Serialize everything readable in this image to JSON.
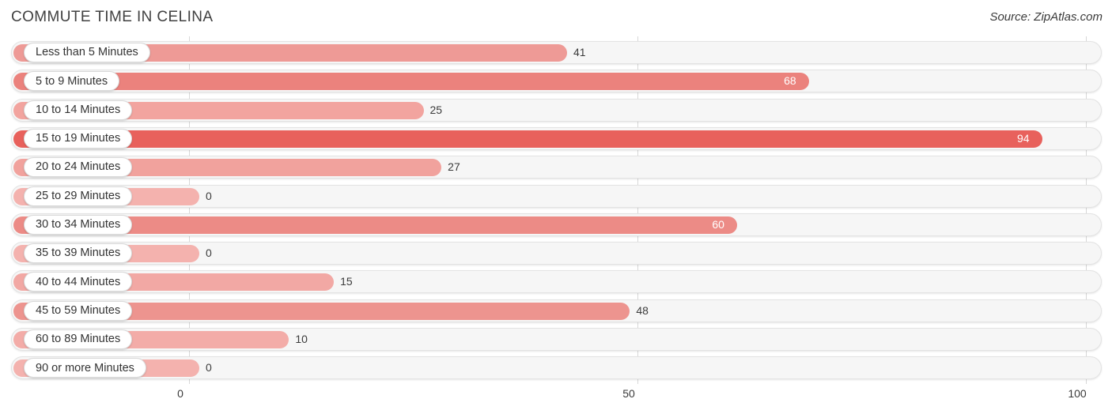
{
  "header": {
    "title": "COMMUTE TIME IN CELINA",
    "source": "Source: ZipAtlas.com"
  },
  "axis": {
    "ticks": [
      "0",
      "50",
      "100"
    ],
    "min": 0,
    "max": 100
  },
  "colors": {
    "bar_low": "#F4B2AE",
    "bar_mid": "#EE9A96",
    "bar_high": "#E8615C",
    "track_fill": "#F6F6F6",
    "track_border": "#E3E3E3",
    "gridline": "#D8D8D8",
    "pill_bg": "#FFFFFF",
    "text": "#3B3B3B"
  },
  "chart_data": {
    "type": "bar",
    "orientation": "horizontal",
    "title": "COMMUTE TIME IN CELINA",
    "subtitle": "",
    "xlabel": "",
    "ylabel": "",
    "xlim": [
      0,
      100
    ],
    "grid": true,
    "legend": "none",
    "categories": [
      "Less than 5 Minutes",
      "5 to 9 Minutes",
      "10 to 14 Minutes",
      "15 to 19 Minutes",
      "20 to 24 Minutes",
      "25 to 29 Minutes",
      "30 to 34 Minutes",
      "35 to 39 Minutes",
      "40 to 44 Minutes",
      "45 to 59 Minutes",
      "60 to 89 Minutes",
      "90 or more Minutes"
    ],
    "values": [
      41,
      68,
      25,
      94,
      27,
      0,
      60,
      0,
      15,
      48,
      10,
      0
    ],
    "value_labels": [
      "41",
      "68",
      "25",
      "94",
      "27",
      "0",
      "60",
      "0",
      "15",
      "48",
      "10",
      "0"
    ]
  },
  "rows": [
    {
      "label": "Less than 5 Minutes",
      "value": 41,
      "value_label": "41",
      "inside": false,
      "color": "#EE9A96"
    },
    {
      "label": "5 to 9 Minutes",
      "value": 68,
      "value_label": "68",
      "inside": true,
      "color": "#EB827D"
    },
    {
      "label": "10 to 14 Minutes",
      "value": 25,
      "value_label": "25",
      "inside": false,
      "color": "#F2A49F"
    },
    {
      "label": "15 to 19 Minutes",
      "value": 94,
      "value_label": "94",
      "inside": true,
      "color": "#E8615C"
    },
    {
      "label": "20 to 24 Minutes",
      "value": 27,
      "value_label": "27",
      "inside": false,
      "color": "#F1A29D"
    },
    {
      "label": "25 to 29 Minutes",
      "value": 0,
      "value_label": "0",
      "inside": false,
      "color": "#F4B2AE"
    },
    {
      "label": "30 to 34 Minutes",
      "value": 60,
      "value_label": "60",
      "inside": true,
      "color": "#EC8B86"
    },
    {
      "label": "35 to 39 Minutes",
      "value": 0,
      "value_label": "0",
      "inside": false,
      "color": "#F4B2AE"
    },
    {
      "label": "40 to 44 Minutes",
      "value": 15,
      "value_label": "15",
      "inside": false,
      "color": "#F2A8A4"
    },
    {
      "label": "45 to 59 Minutes",
      "value": 48,
      "value_label": "48",
      "inside": false,
      "color": "#ED948F"
    },
    {
      "label": "60 to 89 Minutes",
      "value": 10,
      "value_label": "10",
      "inside": false,
      "color": "#F3ACA8"
    },
    {
      "label": "90 or more Minutes",
      "value": 0,
      "value_label": "0",
      "inside": false,
      "color": "#F4B2AE"
    }
  ]
}
